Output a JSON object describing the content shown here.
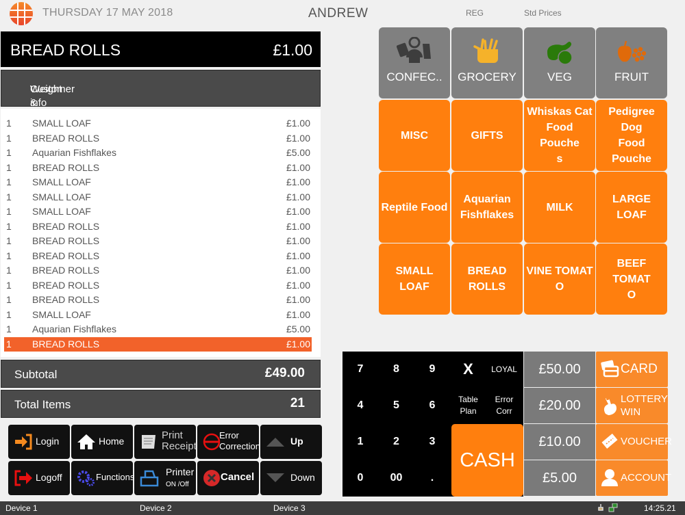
{
  "header": {
    "date": "THURSDAY 17 MAY 2018",
    "user": "ANDREW",
    "mode": "REG",
    "price_level": "Std Prices",
    "logo_icon": "grid-logo-icon"
  },
  "current_item": {
    "name": "BREAD ROLLS",
    "price": "£1.00"
  },
  "customer_button": {
    "label_line1": "Customer &",
    "label_line2": "Weight info"
  },
  "receipt": {
    "items": [
      {
        "qty": "1",
        "desc": "SMALL LOAF",
        "price": "£1.00"
      },
      {
        "qty": "1",
        "desc": "BREAD ROLLS",
        "price": "£1.00"
      },
      {
        "qty": "1",
        "desc": "Aquarian Fishflakes",
        "price": "£5.00"
      },
      {
        "qty": "1",
        "desc": "BREAD ROLLS",
        "price": "£1.00"
      },
      {
        "qty": "1",
        "desc": "SMALL LOAF",
        "price": "£1.00"
      },
      {
        "qty": "1",
        "desc": "SMALL LOAF",
        "price": "£1.00"
      },
      {
        "qty": "1",
        "desc": "SMALL LOAF",
        "price": "£1.00"
      },
      {
        "qty": "1",
        "desc": "BREAD ROLLS",
        "price": "£1.00"
      },
      {
        "qty": "1",
        "desc": "BREAD ROLLS",
        "price": "£1.00"
      },
      {
        "qty": "1",
        "desc": "BREAD ROLLS",
        "price": "£1.00"
      },
      {
        "qty": "1",
        "desc": "BREAD ROLLS",
        "price": "£1.00"
      },
      {
        "qty": "1",
        "desc": "BREAD ROLLS",
        "price": "£1.00"
      },
      {
        "qty": "1",
        "desc": "BREAD ROLLS",
        "price": "£1.00"
      },
      {
        "qty": "1",
        "desc": "SMALL LOAF",
        "price": "£1.00"
      },
      {
        "qty": "1",
        "desc": "Aquarian Fishflakes",
        "price": "£5.00"
      },
      {
        "qty": "1",
        "desc": "BREAD ROLLS",
        "price": "£1.00",
        "selected": true
      }
    ],
    "selected_color": "#f2622a"
  },
  "totals": {
    "subtotal_label": "Subtotal",
    "subtotal_value": "£49.00",
    "items_label": "Total Items",
    "items_value": "21"
  },
  "function_buttons": [
    {
      "label": "Login",
      "icon": "login-arrow-icon"
    },
    {
      "label": "Home",
      "icon": "home-icon"
    },
    {
      "label": "Print\nReceipt",
      "line1": "Print",
      "line2": "Receipt",
      "icon": "receipt-icon"
    },
    {
      "label": "Error Correction",
      "line1": "Error",
      "line2": "Correction",
      "icon": "no-entry-icon"
    },
    {
      "label": "Up",
      "icon": "arrow-up-icon"
    },
    {
      "label": "Logoff",
      "icon": "logoff-arrow-icon"
    },
    {
      "label": "Functions",
      "icon": "gears-icon"
    },
    {
      "label": "Printer ON /Off",
      "line1": "Printer",
      "line2": "ON /Off",
      "icon": "printer-icon"
    },
    {
      "label": "Cancel",
      "icon": "cancel-x-icon"
    },
    {
      "label": "Down",
      "icon": "arrow-down-icon"
    }
  ],
  "categories": [
    {
      "label": "CONFEC..",
      "icon": "confectionery-icon"
    },
    {
      "label": "GROCERY",
      "icon": "grocery-basket-icon"
    },
    {
      "label": "VEG",
      "icon": "vegetables-icon"
    },
    {
      "label": "FRUIT",
      "icon": "fruit-icon"
    }
  ],
  "products": [
    "MISC",
    "GIFTS",
    "Whiskas Cat Food Pouches",
    "Pedigree Dog Food Pouche",
    "Reptile Food",
    "Aquarian Fishflakes",
    "MILK",
    "LARGE LOAF",
    "SMALL LOAF",
    "BREAD ROLLS",
    "VINE TOMATO",
    "BEEF TOMATO"
  ],
  "product_display": [
    "MISC",
    "GIFTS",
    "Whiskas Cat\nFood Pouche\ns",
    "Pedigree Dog\nFood Pouche",
    "Reptile Food",
    "Aquarian\nFishflakes",
    "MILK",
    "LARGE LOAF",
    "SMALL LOAF",
    "BREAD\nROLLS",
    "VINE TOMAT\nO",
    "BEEF TOMAT\nO"
  ],
  "keypad": {
    "keys": [
      "7",
      "8",
      "9",
      "X",
      "LOYAL",
      "4",
      "5",
      "6",
      "Table Plan",
      "Error Corr",
      "1",
      "2",
      "3",
      "0",
      "00",
      "."
    ],
    "cash_label": "CASH"
  },
  "quick_cash": [
    "£50.00",
    "£20.00",
    "£10.00",
    "£5.00"
  ],
  "payment": [
    {
      "label": "CARD",
      "icon": "credit-card-icon"
    },
    {
      "label": "LOTTERY WIN",
      "line1": "LOTTERY",
      "line2": "WIN",
      "icon": "lottery-crossed-fingers-icon"
    },
    {
      "label": "VOUCHER",
      "icon": "voucher-ticket-icon"
    },
    {
      "label": "ACCOUNT",
      "icon": "account-person-icon"
    }
  ],
  "statusbar": {
    "device1": "Device 1",
    "device2": "Device 2",
    "device3": "Device 3",
    "time": "14:25.21",
    "tray_icons": [
      "network-plug-icon",
      "network-computers-icon"
    ]
  },
  "colors": {
    "orange": "#ff7f0e",
    "gray_tile": "#808080",
    "dark_bar": "#4a4a4a"
  }
}
